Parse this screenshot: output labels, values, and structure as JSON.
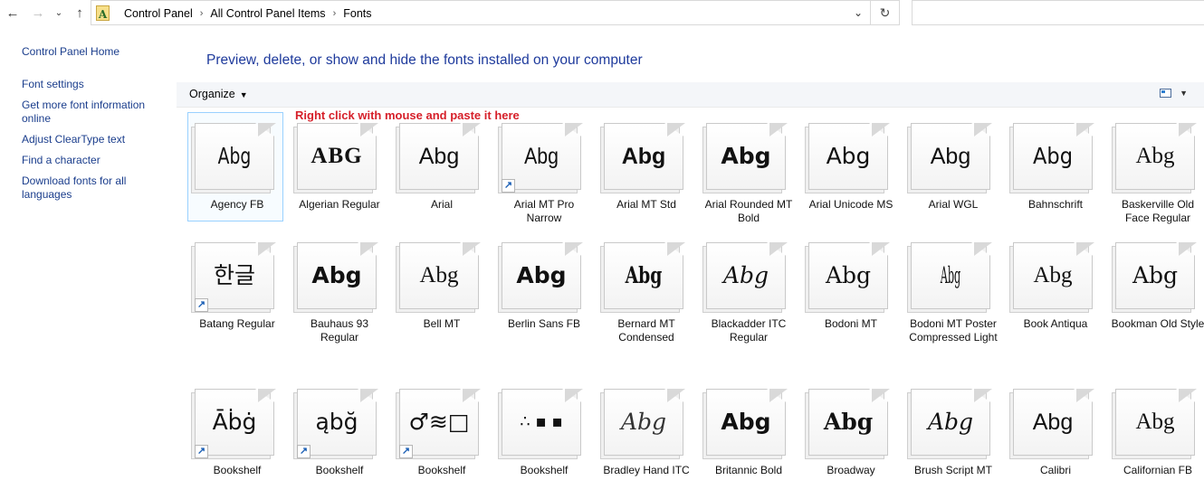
{
  "address": {
    "crumbs": [
      "Control Panel",
      "All Control Panel Items",
      "Fonts"
    ]
  },
  "left_pane": {
    "links": [
      "Control Panel Home",
      "Font settings",
      "Get more font information online",
      "Adjust ClearType text",
      "Find a character",
      "Download fonts for all languages"
    ]
  },
  "heading": "Preview, delete, or show and hide the fonts installed on your computer",
  "toolbar": {
    "organize_label": "Organize"
  },
  "annotation": "Right click with mouse and paste it here",
  "fonts": [
    {
      "name": "Agency FB",
      "sample": "Abg",
      "style": "font-family:'DejaVu Sans',sans-serif;transform:scaleX(0.75);",
      "shortcut": false,
      "selected": true
    },
    {
      "name": "Algerian Regular",
      "sample": "ABG",
      "style": "font-family:'Liberation Serif',serif;font-weight:bold;letter-spacing:1px;",
      "shortcut": false
    },
    {
      "name": "Arial",
      "sample": "Abg",
      "style": "font-family:'Liberation Sans',sans-serif;",
      "shortcut": false
    },
    {
      "name": "Arial MT Pro Narrow",
      "sample": "Abg",
      "style": "font-family:'Liberation Sans',sans-serif;transform:scaleX(0.85);",
      "shortcut": true
    },
    {
      "name": "Arial MT Std",
      "sample": "Abg",
      "style": "font-family:'Liberation Sans',sans-serif;font-weight:bold;",
      "shortcut": false
    },
    {
      "name": "Arial Rounded MT Bold",
      "sample": "Abg",
      "style": "font-family:'DejaVu Sans',sans-serif;font-weight:bold;",
      "shortcut": false
    },
    {
      "name": "Arial Unicode MS",
      "sample": "Abg",
      "style": "font-family:'DejaVu Sans',sans-serif;",
      "shortcut": false
    },
    {
      "name": "Arial WGL",
      "sample": "Abg",
      "style": "font-family:'Liberation Sans',sans-serif;",
      "shortcut": false
    },
    {
      "name": "Bahnschrift",
      "sample": "Abg",
      "style": "font-family:'DejaVu Sans',sans-serif;transform:scaleX(0.9);",
      "shortcut": false
    },
    {
      "name": "Baskerville Old Face Regular",
      "sample": "Abg",
      "style": "font-family:'Liberation Serif',serif;",
      "shortcut": false
    },
    {
      "name": "Batang Regular",
      "sample": "한글",
      "style": "font-family:'DejaVu Serif',serif;",
      "shortcut": true
    },
    {
      "name": "Bauhaus 93 Regular",
      "sample": "Abg",
      "style": "font-family:'DejaVu Sans',sans-serif;font-weight:bold;",
      "shortcut": false
    },
    {
      "name": "Bell MT",
      "sample": "Abg",
      "style": "font-family:'Liberation Serif',serif;",
      "shortcut": false
    },
    {
      "name": "Berlin Sans FB",
      "sample": "Abg",
      "style": "font-family:'DejaVu Sans',sans-serif;font-weight:bold;",
      "shortcut": false
    },
    {
      "name": "Bernard MT Condensed",
      "sample": "Abg",
      "style": "font-family:'DejaVu Serif',serif;font-weight:bold;transform:scaleX(0.75);",
      "shortcut": false
    },
    {
      "name": "Blackadder ITC Regular",
      "sample": "Abg",
      "style": "font-family:'DejaVu Serif',serif;font-style:italic;",
      "shortcut": false
    },
    {
      "name": "Bodoni MT",
      "sample": "Abg",
      "style": "font-family:'DejaVu Serif',serif;",
      "shortcut": false
    },
    {
      "name": "Bodoni MT Poster Compressed Light",
      "sample": "Abg",
      "style": "font-family:'DejaVu Serif',serif;transform:scaleX(0.45);",
      "shortcut": false
    },
    {
      "name": "Book Antiqua",
      "sample": "Abg",
      "style": "font-family:'Liberation Serif',serif;",
      "shortcut": false
    },
    {
      "name": "Bookman Old Style",
      "sample": "Abg",
      "style": "font-family:'DejaVu Serif',serif;",
      "shortcut": false
    },
    {
      "name": "Bookshelf",
      "sample": "Āḃġ",
      "style": "font-family:'DejaVu Sans',sans-serif;",
      "shortcut": true
    },
    {
      "name": "Bookshelf",
      "sample": "ąbğ",
      "style": "font-family:'DejaVu Sans',sans-serif;",
      "shortcut": true
    },
    {
      "name": "Bookshelf",
      "sample": "♂≋□",
      "style": "font-family:'DejaVu Sans',sans-serif;",
      "shortcut": true
    },
    {
      "name": "Bookshelf",
      "sample": "∴ ▪ ▪",
      "style": "font-family:'DejaVu Sans',sans-serif;font-size:18px;",
      "shortcut": false
    },
    {
      "name": "Bradley Hand ITC",
      "sample": "Abg",
      "style": "font-family:'DejaVu Serif',serif;font-style:italic;font-weight:normal;color:#333;",
      "shortcut": false
    },
    {
      "name": "Britannic Bold",
      "sample": "Abg",
      "style": "font-family:'DejaVu Sans',sans-serif;font-weight:bold;",
      "shortcut": false
    },
    {
      "name": "Broadway",
      "sample": "Abg",
      "style": "font-family:'DejaVu Serif',serif;font-weight:bold;",
      "shortcut": false
    },
    {
      "name": "Brush Script MT",
      "sample": "Abg",
      "style": "font-family:'DejaVu Serif',serif;font-style:italic;",
      "shortcut": false
    },
    {
      "name": "Calibri",
      "sample": "Abg",
      "style": "font-family:'Liberation Sans',sans-serif;",
      "shortcut": false
    },
    {
      "name": "Californian FB",
      "sample": "Abg",
      "style": "font-family:'Liberation Serif',serif;",
      "shortcut": false
    }
  ]
}
